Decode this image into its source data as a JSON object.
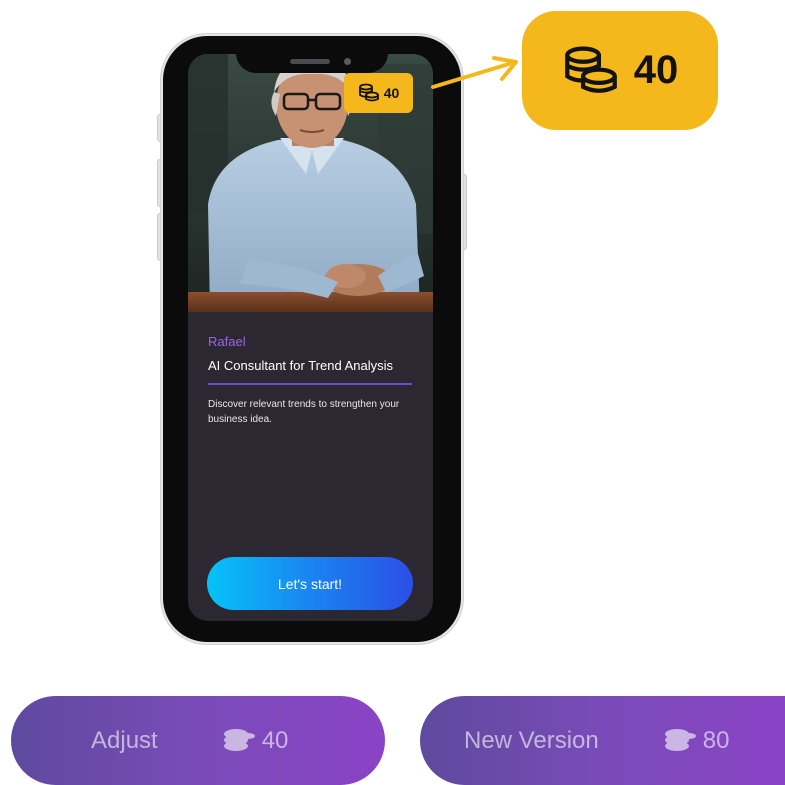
{
  "badge": {
    "coins": "40"
  },
  "callout": {
    "coins": "40"
  },
  "persona": {
    "name": "Rafael",
    "role": "AI Consultant for Trend Analysis",
    "description": "Discover relevant trends to strengthen your business idea."
  },
  "start_button": {
    "label": "Let's start!"
  },
  "actions": {
    "adjust": {
      "label": "Adjust",
      "cost": "40"
    },
    "new_version": {
      "label": "New Version",
      "cost": "80"
    }
  },
  "colors": {
    "coin_yellow": "#f4b81c",
    "accent_purple": "#9a66ea",
    "start_gradient": [
      "#06c2f8",
      "#2c4fe6"
    ],
    "pill_gradient": [
      "#5e4a9e",
      "#8a43c6"
    ],
    "card_bg": "#2b2832"
  },
  "icons": {
    "coin": "coins-stack-icon",
    "arrow": "arrow-right-icon"
  }
}
